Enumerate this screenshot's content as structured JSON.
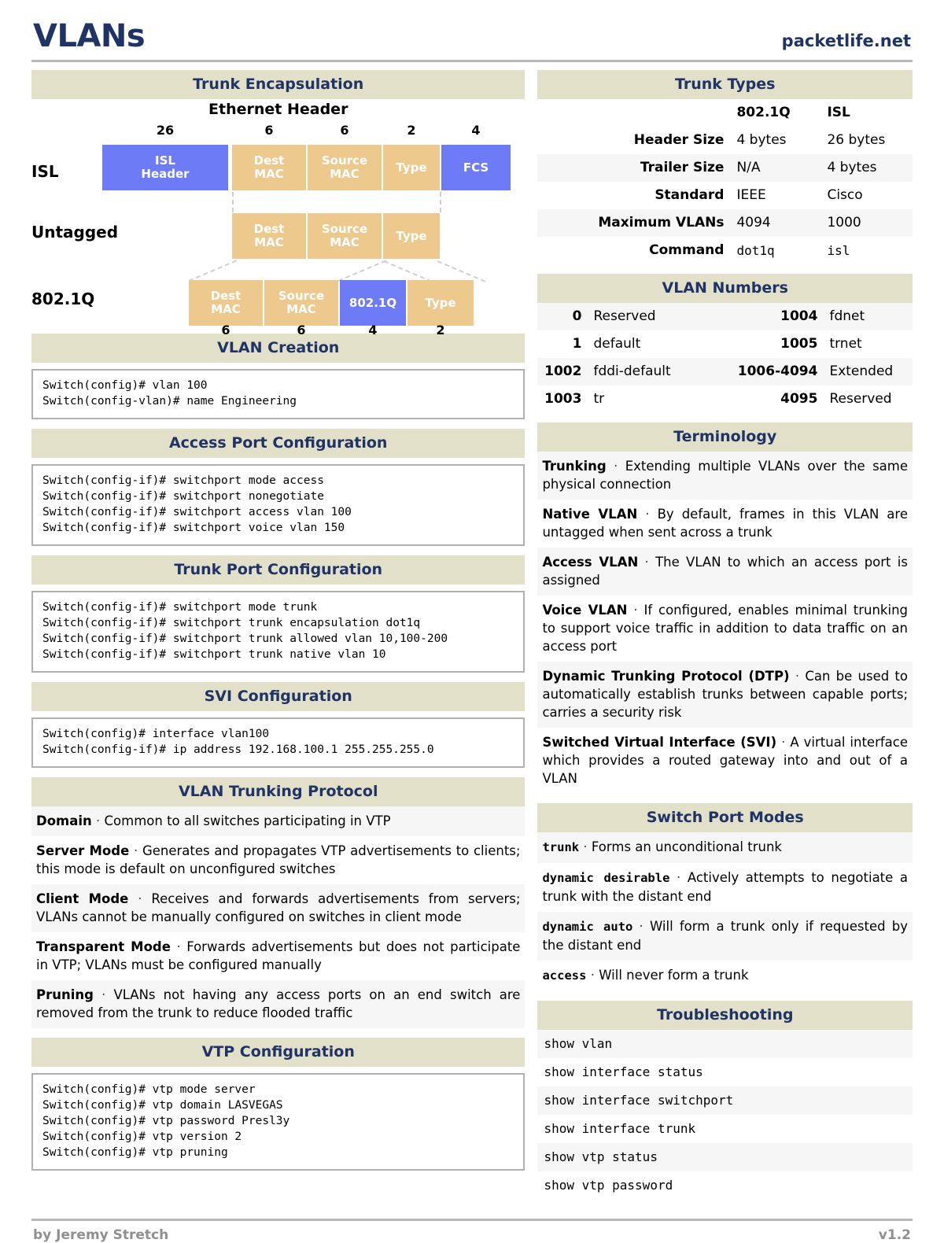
{
  "header": {
    "title": "VLANs",
    "brand": "packetlife.net"
  },
  "footer": {
    "author": "by Jeremy Stretch",
    "version": "v1.2"
  },
  "sections": {
    "trunk_encapsulation": "Trunk Encapsulation",
    "vlan_creation": "VLAN Creation",
    "access_port_configuration": "Access Port Configuration",
    "trunk_port_configuration": "Trunk Port Configuration",
    "svi_configuration": "SVI Configuration",
    "vlan_trunking_protocol": "VLAN Trunking Protocol",
    "vtp_configuration": "VTP Configuration",
    "trunk_types": "Trunk Types",
    "vlan_numbers": "VLAN Numbers",
    "terminology": "Terminology",
    "switch_port_modes": "Switch Port Modes",
    "troubleshooting": "Troubleshooting"
  },
  "diagram": {
    "title": "Ethernet Header",
    "colors": {
      "tan": "#eec98e",
      "blue": "#6e7bf7"
    },
    "top_sizes": [
      "26",
      "6",
      "6",
      "2",
      "4"
    ],
    "bottom_sizes": [
      "6",
      "6",
      "4",
      "2"
    ],
    "rows": [
      {
        "label": "ISL",
        "blocks": [
          {
            "text": "ISL\nHeader",
            "color": "blue"
          },
          {
            "text": "Dest\nMAC",
            "color": "tan"
          },
          {
            "text": "Source\nMAC",
            "color": "tan"
          },
          {
            "text": "Type",
            "color": "tan"
          },
          {
            "text": "FCS",
            "color": "blue"
          }
        ]
      },
      {
        "label": "Untagged",
        "blocks": [
          {
            "text": "Dest\nMAC",
            "color": "tan"
          },
          {
            "text": "Source\nMAC",
            "color": "tan"
          },
          {
            "text": "Type",
            "color": "tan"
          }
        ]
      },
      {
        "label": "802.1Q",
        "blocks": [
          {
            "text": "Dest\nMAC",
            "color": "tan"
          },
          {
            "text": "Source\nMAC",
            "color": "tan"
          },
          {
            "text": "802.1Q",
            "color": "blue"
          },
          {
            "text": "Type",
            "color": "tan"
          }
        ]
      }
    ],
    "isl_header_line1": "ISL",
    "isl_header_line2": "Header",
    "dest_line1": "Dest",
    "dest_line2": "MAC",
    "source_line1": "Source",
    "source_line2": "MAC",
    "type_text": "Type",
    "fcs_text": "FCS",
    "dot1q_text": "802.1Q",
    "label_isl": "ISL",
    "label_untagged": "Untagged",
    "label_dot1q": "802.1Q"
  },
  "code_blocks": {
    "vlan_creation": [
      "Switch(config)# vlan 100",
      "Switch(config-vlan)# name Engineering"
    ],
    "access_port": [
      "Switch(config-if)# switchport mode access",
      "Switch(config-if)# switchport nonegotiate",
      "Switch(config-if)# switchport access vlan 100",
      "Switch(config-if)# switchport voice vlan 150"
    ],
    "trunk_port": [
      "Switch(config-if)# switchport mode trunk",
      "Switch(config-if)# switchport trunk encapsulation dot1q",
      "Switch(config-if)# switchport trunk allowed vlan 10,100-200",
      "Switch(config-if)# switchport trunk native vlan 10"
    ],
    "svi": [
      "Switch(config)# interface vlan100",
      "Switch(config-if)# ip address 192.168.100.1 255.255.255.0"
    ],
    "vtp": [
      "Switch(config)# vtp mode server",
      "Switch(config)# vtp domain LASVEGAS",
      "Switch(config)# vtp password Presl3y",
      "Switch(config)# vtp version 2",
      "Switch(config)# vtp pruning"
    ]
  },
  "vtp_definitions": [
    {
      "term": "Domain",
      "desc": "Common to all switches participating in VTP"
    },
    {
      "term": "Server Mode",
      "desc": "Generates and propagates VTP advertisements to clients; this mode is default on unconfigured switches"
    },
    {
      "term": "Client Mode",
      "desc": "Receives and forwards advertisements from servers; VLANs cannot be manually configured on switches in client mode"
    },
    {
      "term": "Transparent Mode",
      "desc": "Forwards advertisements but does not participate in VTP; VLANs must be configured manually"
    },
    {
      "term": "Pruning",
      "desc": "VLANs not having any access ports on an end switch are removed from the trunk to reduce flooded traffic"
    }
  ],
  "trunk_types": {
    "col1": "802.1Q",
    "col2": "ISL",
    "rows": [
      {
        "label": "Header Size",
        "v1": "4 bytes",
        "v2": "26 bytes",
        "mono": false
      },
      {
        "label": "Trailer Size",
        "v1": "N/A",
        "v2": "4 bytes",
        "mono": false
      },
      {
        "label": "Standard",
        "v1": "IEEE",
        "v2": "Cisco",
        "mono": false
      },
      {
        "label": "Maximum VLANs",
        "v1": "4094",
        "v2": "1000",
        "mono": false
      },
      {
        "label": "Command",
        "v1": "dot1q",
        "v2": "isl",
        "mono": true
      }
    ]
  },
  "vlan_numbers": [
    {
      "n1": "0",
      "name1": "Reserved",
      "n2": "1004",
      "name2": "fdnet"
    },
    {
      "n1": "1",
      "name1": "default",
      "n2": "1005",
      "name2": "trnet"
    },
    {
      "n1": "1002",
      "name1": "fddi-default",
      "n2": "1006-4094",
      "name2": "Extended"
    },
    {
      "n1": "1003",
      "name1": "tr",
      "n2": "4095",
      "name2": "Reserved"
    }
  ],
  "terminology": [
    {
      "term": "Trunking",
      "desc": "Extending multiple VLANs over the same physical connection"
    },
    {
      "term": "Native VLAN",
      "desc": "By default, frames in this VLAN are untagged when sent across a trunk"
    },
    {
      "term": "Access VLAN",
      "desc": "The VLAN to which an access port is assigned"
    },
    {
      "term": "Voice VLAN",
      "desc": "If configured, enables minimal trunking to support voice traffic in addition to data traffic on an access port"
    },
    {
      "term": "Dynamic Trunking Protocol (DTP)",
      "desc": "Can be used to automatically establish trunks between capable ports; carries a security risk"
    },
    {
      "term": "Switched Virtual Interface (SVI)",
      "desc": "A virtual interface which provides a routed gateway into and out of a VLAN"
    }
  ],
  "switch_port_modes": [
    {
      "term": "trunk",
      "desc": "Forms an unconditional trunk"
    },
    {
      "term": "dynamic desirable",
      "desc": "Actively attempts to negotiate a trunk with the distant end"
    },
    {
      "term": "dynamic auto",
      "desc": "Will form a trunk only if requested by the distant end"
    },
    {
      "term": "access",
      "desc": "Will never form a trunk"
    }
  ],
  "troubleshooting": [
    "show vlan",
    "show interface status",
    "show interface switchport",
    "show interface trunk",
    "show vtp status",
    "show vtp password"
  ]
}
